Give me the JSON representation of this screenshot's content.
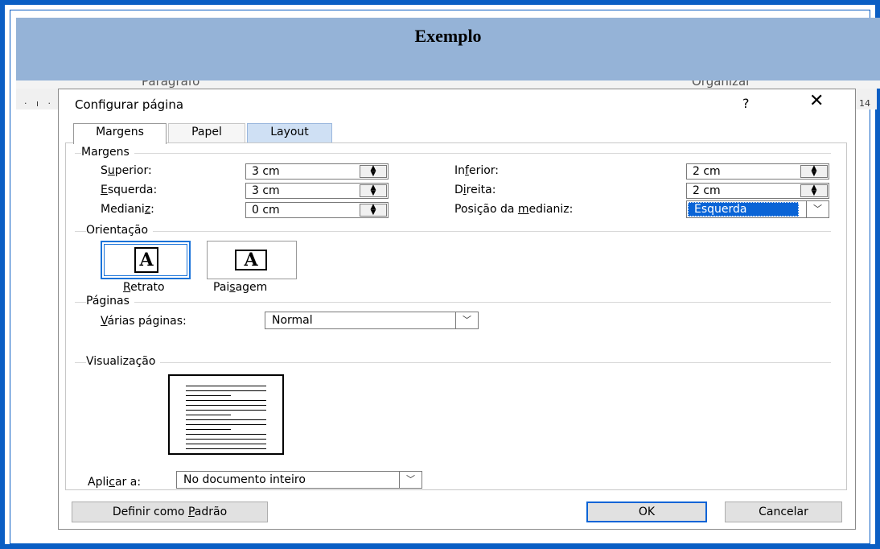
{
  "header": {
    "title": "Exemplo"
  },
  "ribbon": {
    "paragraph_label": "Parágrafo",
    "organize_label": "Organizar"
  },
  "ruler": {
    "left_marks": "· ı ·",
    "right_number": "14"
  },
  "dialog": {
    "title": "Configurar página",
    "help": "?",
    "close": "✕",
    "tabs": [
      "Margens",
      "Papel",
      "Layout"
    ],
    "margins": {
      "group_label": "Margens",
      "superior_label": "Superior:",
      "superior_value": "3 cm",
      "esquerda_label": "Esquerda:",
      "esquerda_value": "3 cm",
      "medianiz_label": "Medianiz:",
      "medianiz_value": "0 cm",
      "inferior_label": "Inferior:",
      "inferior_value": "2 cm",
      "direita_label": "Direita:",
      "direita_value": "2 cm",
      "posicao_label": "Posição da medianiz:",
      "posicao_value": "Esquerda"
    },
    "orientation": {
      "group_label": "Orientação",
      "portrait": "Retrato",
      "landscape": "Paisagem",
      "selected": "Retrato"
    },
    "pages": {
      "group_label": "Páginas",
      "multiple_label": "Várias páginas:",
      "multiple_value": "Normal"
    },
    "preview": {
      "group_label": "Visualização"
    },
    "apply": {
      "label": "Aplicar a:",
      "value": "No documento inteiro"
    },
    "buttons": {
      "set_default": "Definir como Padrão",
      "ok": "OK",
      "cancel": "Cancelar"
    }
  },
  "colors": {
    "frame": "#0a5ec4",
    "header_bg": "#95b3d7",
    "selection": "#0a64d6"
  }
}
